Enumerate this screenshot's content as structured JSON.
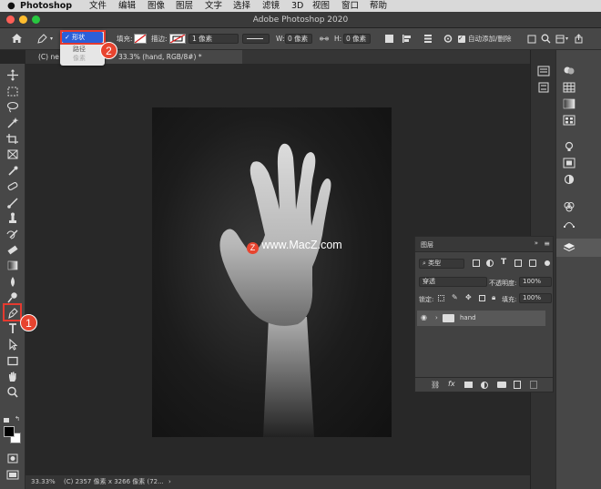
{
  "menubar": {
    "app_name": "Photoshop",
    "items": [
      "文件",
      "编辑",
      "图像",
      "图层",
      "文字",
      "选择",
      "滤镜",
      "3D",
      "视图",
      "窗口",
      "帮助"
    ]
  },
  "window": {
    "title": "Adobe Photoshop 2020"
  },
  "options": {
    "fill_label": "填充:",
    "stroke_label": "描边:",
    "stroke_width": "1 像素",
    "w_label": "W:",
    "w_value": "0 像素",
    "h_label": "H:",
    "h_value": "0 像素",
    "auto_add_label": "自动添加/删除"
  },
  "mode_popup": {
    "selected": "形状",
    "items": [
      "路径",
      "像素"
    ]
  },
  "tabs": [
    "(C) ne",
    "33.3% (hand, RGB/8#) *"
  ],
  "document": {
    "watermark": "www.MacZ.com"
  },
  "status": {
    "zoom": "33.33%",
    "info": "(C) 2357 像素 x 3266 像素 (72..."
  },
  "layers_panel": {
    "title": "图层",
    "kind_filter": "类型",
    "blend_mode": "穿透",
    "opacity_label": "不透明度:",
    "opacity_value": "100%",
    "lock_label": "锁定:",
    "fill_label": "填充:",
    "fill_value": "100%",
    "layer_name": "hand"
  },
  "annotations": {
    "badge1": "1",
    "badge2": "2"
  },
  "colors": {
    "accent": "#2b5fd9",
    "highlight": "#e53a2f"
  }
}
